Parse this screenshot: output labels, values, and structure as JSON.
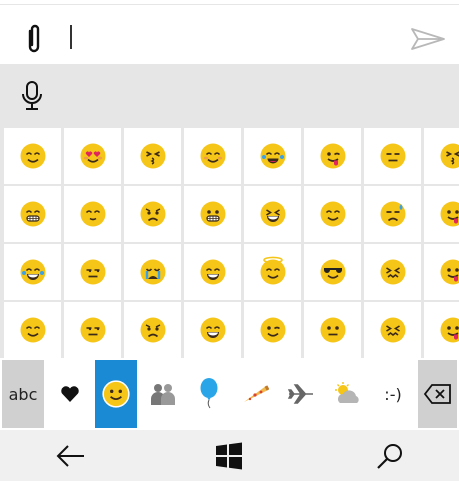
{
  "compose": {
    "attach_icon": "paperclip-icon",
    "send_icon": "send-icon",
    "text_value": ""
  },
  "mic_icon": "microphone-icon",
  "emoji_grid": [
    [
      "smiling-face",
      "heart-eyes-face",
      "kissing-face",
      "blushing-face",
      "laughing-tears-face",
      "tongue-out-face",
      "expressionless-face",
      "kissing-face-partial"
    ],
    [
      "grinning-teeth-face",
      "relieved-face",
      "worried-face",
      "grimacing-face",
      "squinting-laugh-face",
      "smiling-face",
      "sweat-face",
      "tongue-face-partial"
    ],
    [
      "crying-laughing-face",
      "unamused-face",
      "loudly-crying-face",
      "grinning-face",
      "halo-face",
      "sunglasses-face",
      "confounded-face",
      "tongue-face-partial"
    ],
    [
      "smiling-face",
      "unamused-face",
      "frowning-face",
      "grinning-face",
      "winking-face",
      "neutral-face",
      "persevering-face",
      "tongue-face-partial"
    ]
  ],
  "categories": [
    {
      "label": "abc",
      "icon": "",
      "style": "grey"
    },
    {
      "label": "",
      "icon": "heart-icon",
      "style": ""
    },
    {
      "label": "",
      "icon": "smiley-icon",
      "style": "active"
    },
    {
      "label": "",
      "icon": "people-icon",
      "style": ""
    },
    {
      "label": "",
      "icon": "balloon-icon",
      "style": ""
    },
    {
      "label": "",
      "icon": "pizza-icon",
      "style": ""
    },
    {
      "label": "",
      "icon": "airplane-icon",
      "style": ""
    },
    {
      "label": "",
      "icon": "weather-icon",
      "style": ""
    },
    {
      "label": ":-)",
      "icon": "",
      "style": ""
    },
    {
      "label": "",
      "icon": "backspace-icon",
      "style": "grey"
    }
  ],
  "navbar": {
    "back_icon": "back-arrow-icon",
    "start_icon": "windows-icon",
    "search_icon": "search-icon"
  },
  "colors": {
    "emoji_yellow": "#f5c518",
    "accent_blue": "#1a8ad4",
    "grid_gap": "#e6e6e6"
  }
}
